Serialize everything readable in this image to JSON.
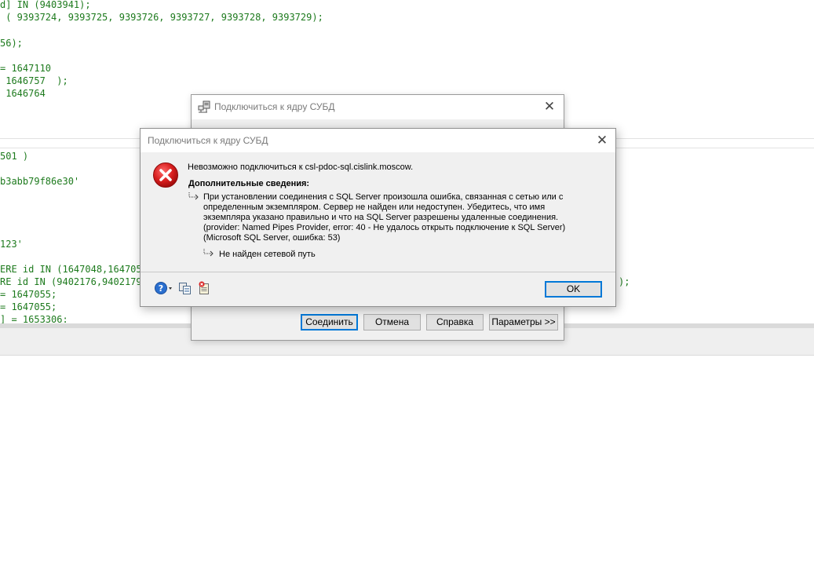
{
  "editor": {
    "top_lines": [
      "d] IN (9403941);",
      " ( 9393724, 9393725, 9393726, 9393727, 9393728, 9393729);",
      "",
      "56);",
      "",
      "= 1647110",
      " 1646757  );",
      " 1646764"
    ],
    "bottom_lines": [
      "501 )",
      "",
      "b3abb79f86e30'",
      "",
      "",
      "",
      "",
      "123'",
      "",
      "ERE id IN (1647048,1647055",
      "RE id IN (9402176,9402179,",
      "= 1647055;",
      "= 1647055;",
      "] = 1653306:"
    ],
    "overflow_text": ");"
  },
  "back_dialog": {
    "title": "Подключиться к ядру СУБД",
    "close_label": "✕",
    "buttons": {
      "connect": "Соединить",
      "cancel": "Отмена",
      "help": "Справка",
      "options": "Параметры >>"
    }
  },
  "error_dialog": {
    "title": "Подключиться к ядру СУБД",
    "close_label": "✕",
    "main_message": "Невозможно подключиться к csl-pdoc-sql.cislink.moscow.",
    "details_header": "Дополнительные сведения:",
    "detail_lines": [
      "При установлении соединения с SQL Server произошла ошибка, связанная с сетью или с",
      "определенным экземпляром. Сервер не найден или недоступен. Убедитесь, что имя",
      "экземпляра указано правильно и что на SQL Server разрешены удаленные соединения.",
      "(provider: Named Pipes Provider, error: 40 - Не удалось открыть подключение к SQL Server)",
      "(Microsoft SQL Server, ошибка: 53)"
    ],
    "sub_detail": "Не найден сетевой путь",
    "ok_label": "OK",
    "icons": {
      "error": "error-x-icon",
      "help": "help-question-icon",
      "copy": "copy-icon",
      "details": "show-details-icon"
    }
  },
  "colors": {
    "code_text": "#1d7a1d",
    "dialog_bg": "#f0f0f0",
    "error_red": "#d81e1e",
    "focus_border": "#0078d7"
  }
}
